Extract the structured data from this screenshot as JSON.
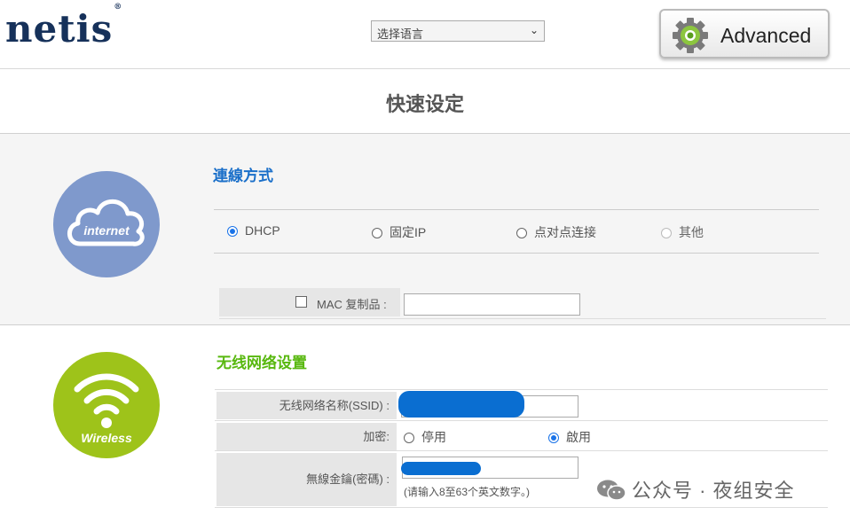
{
  "header": {
    "logo": "netis",
    "logo_mark": "®",
    "language_select": "选择语言",
    "advanced_button": "Advanced",
    "advanced_icon": "gear-icon"
  },
  "page_title": "快速设定",
  "internet": {
    "icon_label": "internet",
    "section_title": "連線方式",
    "connection_types": [
      {
        "label": "DHCP",
        "selected": true
      },
      {
        "label": "固定IP",
        "selected": false
      },
      {
        "label": "点对点连接",
        "selected": false
      },
      {
        "label": "其他",
        "selected": false,
        "disabled": true
      }
    ],
    "mac_clone_label": "MAC 复制品 :",
    "mac_clone_checked": false,
    "mac_clone_value": ""
  },
  "wireless": {
    "icon_label": "Wireless",
    "section_title": "无线网络设置",
    "ssid_label": "无线网络名称(SSID) :",
    "encryption_label": "加密:",
    "encryption_options": [
      {
        "label": "停用",
        "selected": false
      },
      {
        "label": "啟用",
        "selected": true
      }
    ],
    "password_label": "無線金鑰(密碼) :",
    "password_hint": "(请输入8至63个英文数字。)"
  },
  "watermark": "公众号 · 夜组安全",
  "colors": {
    "brand_navy": "#16315a",
    "internet_circle": "#7f99cc",
    "wireless_circle": "#9ec31a",
    "section_title_blue": "#1a6fc9",
    "section_title_green": "#58b80f",
    "redaction": "#0a6ed1"
  }
}
